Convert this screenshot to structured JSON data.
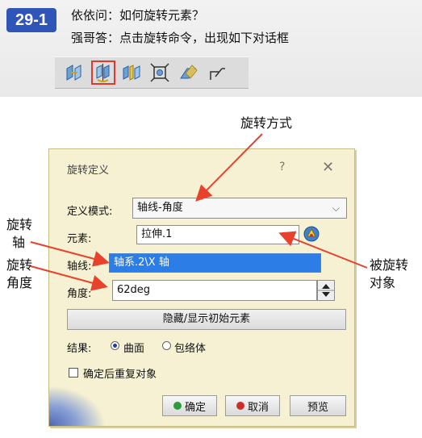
{
  "header": {
    "badge": "29-1",
    "question": "依依问：如何旋转元素？",
    "answer": "强哥答：点击旋转命令，出现如下对话框"
  },
  "toolbar": {
    "icons": [
      "translate-icon",
      "rotate-icon",
      "symmetry-icon",
      "scale-icon",
      "affinity-icon",
      "axis-to-axis-icon"
    ],
    "active_index": 1,
    "highlight_color": "#e03a2f"
  },
  "annotations": {
    "rotation_mode": "旋转方式",
    "rotation_axis_1": "旋转",
    "rotation_axis_2": "轴",
    "rotation_angle_1": "旋转",
    "rotation_angle_2": "角度",
    "rotated_object_1": "被旋转",
    "rotated_object_2": "对象",
    "arrow_color": "#e8412c"
  },
  "dialog": {
    "title": "旋转定义",
    "help": "?",
    "close": "✕",
    "definition_mode_label": "定义模式:",
    "definition_mode_value": "轴线-角度",
    "element_label": "元素:",
    "element_value": "拉伸.1",
    "axis_label": "轴线:",
    "axis_value": "轴系.2\\X 轴",
    "angle_label": "角度:",
    "angle_value": "62deg",
    "show_hide_button": "隐藏/显示初始元素",
    "result_label": "结果:",
    "result_surface": "曲面",
    "result_volume": "包络体",
    "repeat_label": "确定后重复对象",
    "ok": "确定",
    "cancel": "取消",
    "preview": "预览",
    "bg_color": "#f5f1d2",
    "selection_color": "#2d7de6"
  }
}
